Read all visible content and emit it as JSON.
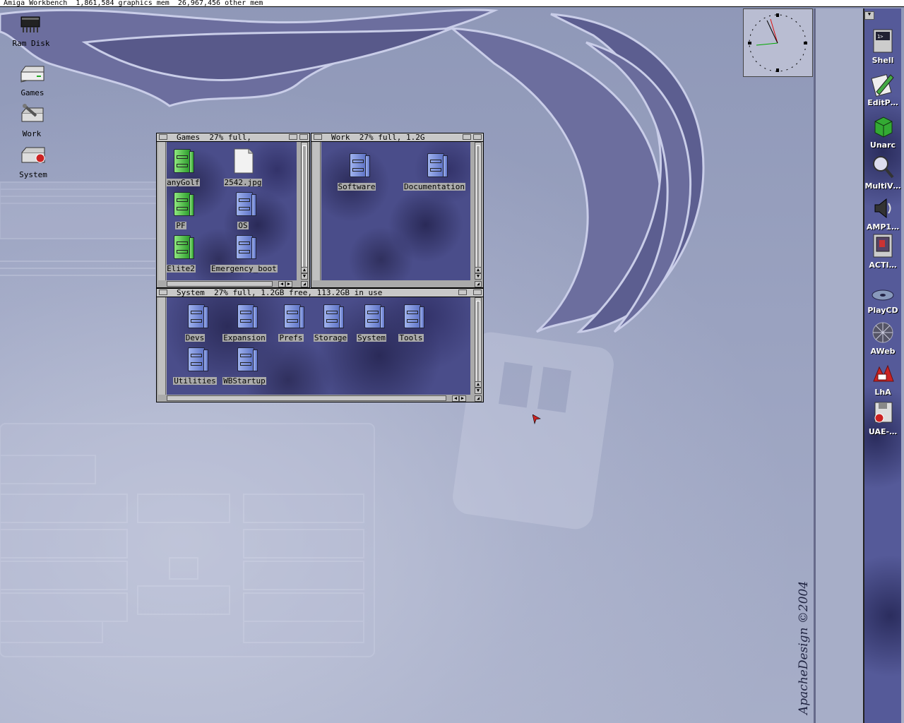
{
  "screen_bar": {
    "text": "Amiga Workbench  1,861,584 graphics mem  26,967,456 other mem"
  },
  "desktop_icons": [
    {
      "label": "Ram Disk"
    },
    {
      "label": "Games"
    },
    {
      "label": "Work"
    },
    {
      "label": "System"
    }
  ],
  "windows": {
    "games": {
      "title": "Games  27% full,",
      "icons": [
        {
          "label": "ZanyGolf",
          "kind": "drawer-green"
        },
        {
          "label": "2542.jpg",
          "kind": "file-page"
        },
        {
          "label": "PF",
          "kind": "drawer-green"
        },
        {
          "label": "OS",
          "kind": "drawer-blue"
        },
        {
          "label": "Elite2",
          "kind": "drawer-green"
        },
        {
          "label": "Emergency_boot",
          "kind": "drawer-blue"
        }
      ]
    },
    "work": {
      "title": "Work  27% full, 1.2G",
      "icons": [
        {
          "label": "Software",
          "kind": "drawer-blue"
        },
        {
          "label": "Documentation",
          "kind": "drawer-blue"
        }
      ]
    },
    "system": {
      "title": "System  27% full, 1.2GB free, 113.2GB in use",
      "icons": [
        {
          "label": "Devs",
          "kind": "drawer-blue"
        },
        {
          "label": "Expansion",
          "kind": "drawer-blue"
        },
        {
          "label": "Prefs",
          "kind": "drawer-blue"
        },
        {
          "label": "Storage",
          "kind": "drawer-blue"
        },
        {
          "label": "System",
          "kind": "drawer-blue"
        },
        {
          "label": "Tools",
          "kind": "drawer-blue"
        },
        {
          "label": "Utilities",
          "kind": "drawer-blue"
        },
        {
          "label": "WBStartup",
          "kind": "drawer-blue"
        }
      ]
    }
  },
  "dock": {
    "items": [
      {
        "label": "Shell",
        "icon": "shell-icon"
      },
      {
        "label": "EditP…",
        "icon": "pencil-icon"
      },
      {
        "label": "Unarc",
        "icon": "cube-icon"
      },
      {
        "label": "MultiV…",
        "icon": "magnifier-icon"
      },
      {
        "label": "AMP1…",
        "icon": "speaker-icon"
      },
      {
        "label": "ACTI…",
        "icon": "screen-icon"
      },
      {
        "label": "PlayCD",
        "icon": "cd-icon"
      },
      {
        "label": "AWeb",
        "icon": "web-icon"
      },
      {
        "label": "LhA",
        "icon": "lha-icon"
      },
      {
        "label": "UAE-…",
        "icon": "floppy-icon"
      }
    ]
  },
  "copyright": "ApacheDesign ©2004",
  "colors": {
    "window_bg": "#aaaaaa",
    "content_bg": "#4a4d8a",
    "desktop_bg": "#8f98b8"
  }
}
